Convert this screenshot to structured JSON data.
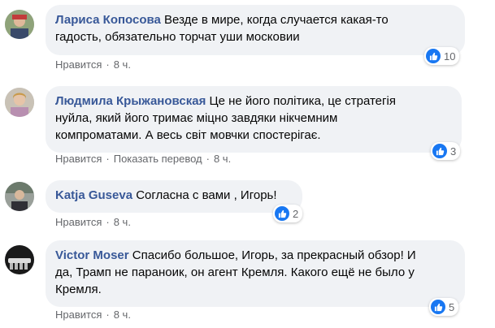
{
  "colors": {
    "author": "#385898",
    "bubble": "#f0f2f5",
    "like": "#1877f2",
    "meta": "#65676b"
  },
  "comments": [
    {
      "author": "Лариса Копосова",
      "text_lines": [
        "Везде в мире, когда случается какая-то",
        "гадость, обязательно торчат уши московии"
      ],
      "reaction_icon": "like-icon",
      "reaction_count": "10",
      "like_label": "Нравится",
      "translate_label": "",
      "time": "8 ч."
    },
    {
      "author": "Людмила Крыжановская",
      "text_lines": [
        "Це не його політика, це стратегія",
        "нуйла, який його тримає міцно завдяки нікчемним",
        "компроматами. А весь світ мовчки спостерігає."
      ],
      "reaction_icon": "like-icon",
      "reaction_count": "3",
      "like_label": "Нравится",
      "translate_label": "Показать перевод",
      "time": "8 ч."
    },
    {
      "author": "Katja Guseva",
      "text_lines": [
        "Согласна с вами , Игорь!"
      ],
      "reaction_icon": "like-icon",
      "reaction_count": "2",
      "like_label": "Нравится",
      "translate_label": "",
      "time": "8 ч."
    },
    {
      "author": "Victor Moser",
      "text_lines": [
        "Спасибо большое, Игорь, за прекрасный обзор! И",
        "да, Трамп не параноик, он агент Кремля. Какого ещё не было у",
        "Кремля."
      ],
      "reaction_icon": "like-icon",
      "reaction_count": "5",
      "like_label": "Нравится",
      "translate_label": "",
      "time": "8 ч."
    }
  ]
}
